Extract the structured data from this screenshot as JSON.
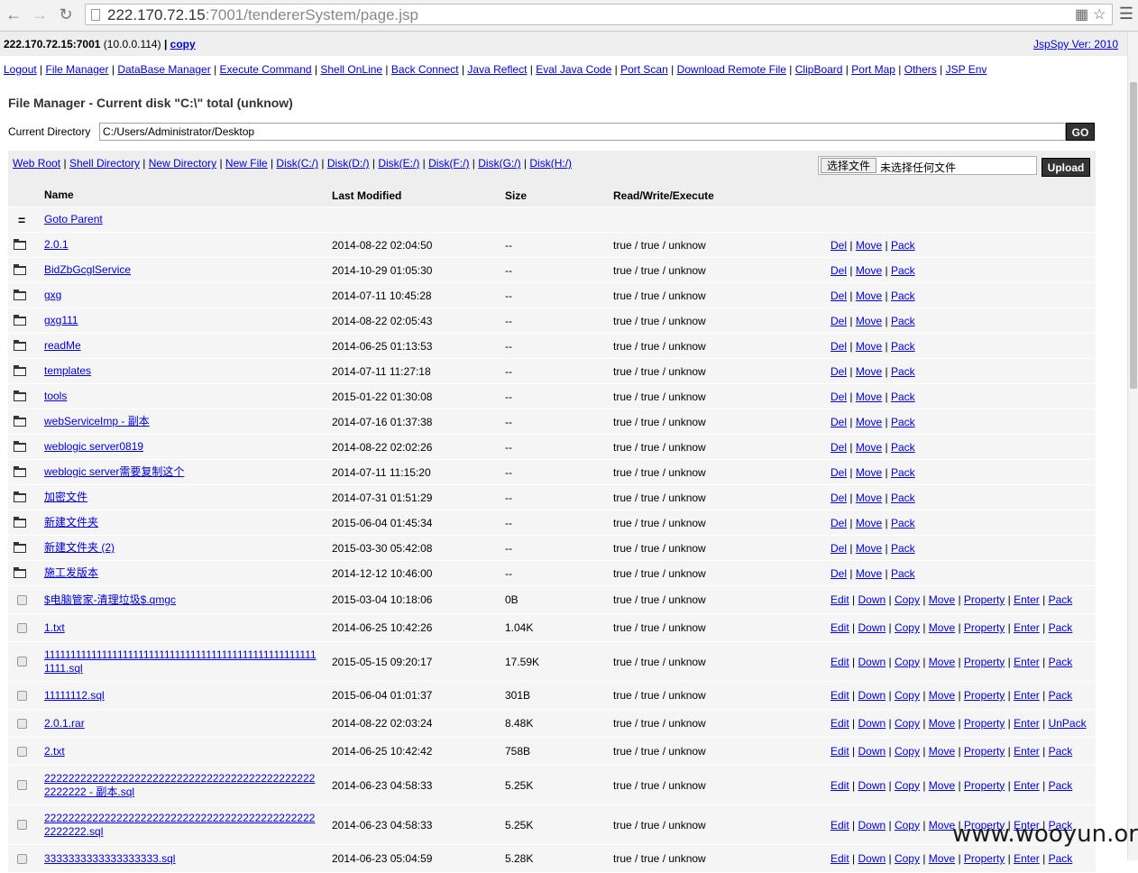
{
  "browser": {
    "url_host": "222.170.72.15",
    "url_rest": ":7001/tendererSystem/page.jsp",
    "back_icon": "back-arrow-icon",
    "forward_icon": "forward-arrow-icon",
    "reload_icon": "reload-icon"
  },
  "topbar": {
    "host": "222.170.72.15:7001",
    "ip": "(10.0.0.114)",
    "sep": "|",
    "copy_label": "copy",
    "version": "JspSpy Ver: 2010"
  },
  "nav": [
    "Logout",
    "File Manager",
    "DataBase Manager",
    "Execute Command",
    "Shell OnLine",
    "Back Connect",
    "Java Reflect",
    "Eval Java Code",
    "Port Scan",
    "Download Remote File",
    "ClipBoard",
    "Port Map",
    "Others",
    "JSP Env"
  ],
  "fm": {
    "title": "File Manager - Current disk \"C:\\\" total (unknow)",
    "dir_label": "Current Directory",
    "dir_value": "C:/Users/Administrator/Desktop",
    "go_label": "GO"
  },
  "tools": [
    "Web Root",
    "Shell Directory",
    "New Directory",
    "New File",
    "Disk(C:/)",
    "Disk(D:/)",
    "Disk(E:/)",
    "Disk(F:/)",
    "Disk(G:/)",
    "Disk(H:/)"
  ],
  "upload": {
    "choose_label": "选择文件",
    "no_file": "未选择任何文件",
    "upload_label": "Upload"
  },
  "columns": {
    "name": "Name",
    "modified": "Last Modified",
    "size": "Size",
    "rwe": "Read/Write/Execute"
  },
  "parent": {
    "icon": "=",
    "label": "Goto Parent"
  },
  "dirs": [
    {
      "name": "2.0.1",
      "modified": "2014-08-22 02:04:50",
      "size": "--",
      "rwe": "true / true / unknow"
    },
    {
      "name": "BidZbGcglService",
      "modified": "2014-10-29 01:05:30",
      "size": "--",
      "rwe": "true / true / unknow"
    },
    {
      "name": "gxg",
      "modified": "2014-07-11 10:45:28",
      "size": "--",
      "rwe": "true / true / unknow"
    },
    {
      "name": "gxg111",
      "modified": "2014-08-22 02:05:43",
      "size": "--",
      "rwe": "true / true / unknow"
    },
    {
      "name": "readMe",
      "modified": "2014-06-25 01:13:53",
      "size": "--",
      "rwe": "true / true / unknow"
    },
    {
      "name": "templates",
      "modified": "2014-07-11 11:27:18",
      "size": "--",
      "rwe": "true / true / unknow"
    },
    {
      "name": "tools",
      "modified": "2015-01-22 01:30:08",
      "size": "--",
      "rwe": "true / true / unknow"
    },
    {
      "name": "webServiceImp - 副本",
      "modified": "2014-07-16 01:37:38",
      "size": "--",
      "rwe": "true / true / unknow"
    },
    {
      "name": "weblogic server0819",
      "modified": "2014-08-22 02:02:26",
      "size": "--",
      "rwe": "true / true / unknow"
    },
    {
      "name": "weblogic server需要复制这个",
      "modified": "2014-07-11 11:15:20",
      "size": "--",
      "rwe": "true / true / unknow"
    },
    {
      "name": "加密文件",
      "modified": "2014-07-31 01:51:29",
      "size": "--",
      "rwe": "true / true / unknow"
    },
    {
      "name": "新建文件夹",
      "modified": "2015-06-04 01:45:34",
      "size": "--",
      "rwe": "true / true / unknow"
    },
    {
      "name": "新建文件夹 (2)",
      "modified": "2015-03-30 05:42:08",
      "size": "--",
      "rwe": "true / true / unknow"
    },
    {
      "name": "施工发版本",
      "modified": "2014-12-12 10:46:00",
      "size": "--",
      "rwe": "true / true / unknow"
    }
  ],
  "dir_actions": [
    "Del",
    "Move",
    "Pack"
  ],
  "files": [
    {
      "name": "$电脑管家-清理垃圾$.qmgc",
      "modified": "2015-03-04 10:18:06",
      "size": "0B",
      "rwe": "true / true / unknow",
      "last_action": "Pack"
    },
    {
      "name": "1.txt",
      "modified": "2014-06-25 10:42:26",
      "size": "1.04K",
      "rwe": "true / true / unknow",
      "last_action": "Pack"
    },
    {
      "name": "11111111111111111111111111111111111111111111111111111111.sql",
      "modified": "2015-05-15 09:20:17",
      "size": "17.59K",
      "rwe": "true / true / unknow",
      "last_action": "Pack"
    },
    {
      "name": "11111112.sql",
      "modified": "2015-06-04 01:01:37",
      "size": "301B",
      "rwe": "true / true / unknow",
      "last_action": "Pack"
    },
    {
      "name": "2.0.1.rar",
      "modified": "2014-08-22 02:03:24",
      "size": "8.48K",
      "rwe": "true / true / unknow",
      "last_action": "UnPack"
    },
    {
      "name": "2.txt",
      "modified": "2014-06-25 10:42:42",
      "size": "758B",
      "rwe": "true / true / unknow",
      "last_action": "Pack"
    },
    {
      "name": "2222222222222222222222222222222222222222222222222222 - 副本.sql",
      "modified": "2014-06-23 04:58:33",
      "size": "5.25K",
      "rwe": "true / true / unknow",
      "last_action": "Pack"
    },
    {
      "name": "2222222222222222222222222222222222222222222222222222.sql",
      "modified": "2014-06-23 04:58:33",
      "size": "5.25K",
      "rwe": "true / true / unknow",
      "last_action": "Pack"
    },
    {
      "name": "3333333333333333333.sql",
      "modified": "2014-06-23 05:04:59",
      "size": "5.28K",
      "rwe": "true / true / unknow",
      "last_action": "Pack"
    }
  ],
  "file_actions": [
    "Edit",
    "Down",
    "Copy",
    "Move",
    "Property",
    "Enter"
  ],
  "watermark": "www.wooyun.org"
}
